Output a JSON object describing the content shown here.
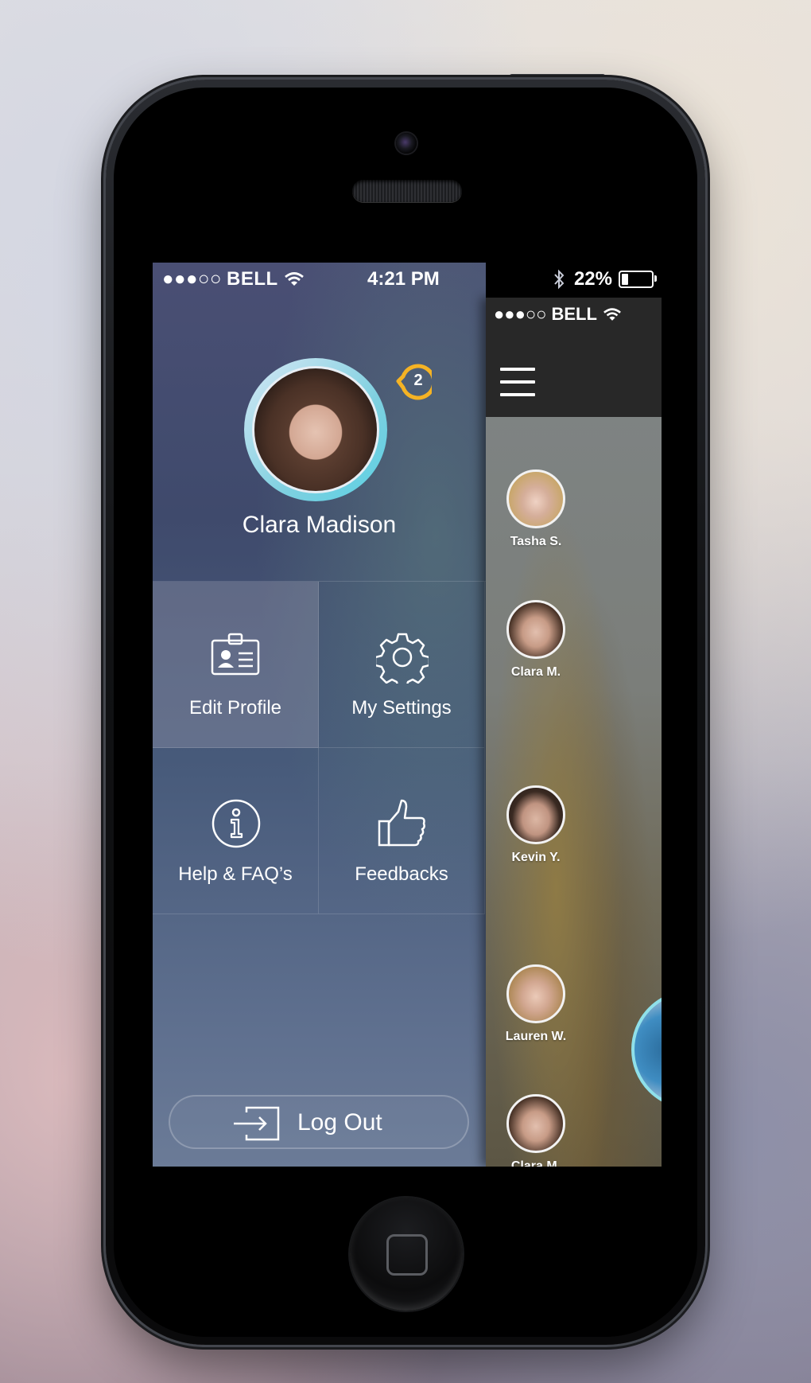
{
  "status_bar": {
    "signal": "●●●○○",
    "carrier": "BELL",
    "time": "4:21 PM",
    "battery_percent": "22%",
    "battery_level": 0.22
  },
  "content_status": {
    "signal": "●●●○○",
    "carrier": "BELL"
  },
  "profile": {
    "name": "Clara Madison",
    "notification_count": "2"
  },
  "menu": {
    "edit_profile": "Edit Profile",
    "my_settings": "My Settings",
    "help": "Help & FAQ’s",
    "feedbacks": "Feedbacks",
    "log_out": "Log Out"
  },
  "contacts": [
    {
      "name": "Tasha S."
    },
    {
      "name": "Clara M."
    },
    {
      "name": "Kevin Y."
    },
    {
      "name": "Lauren W."
    },
    {
      "name": "Clara M."
    }
  ],
  "colors": {
    "accent_badge": "#f5b324",
    "avatar_ring": "#5ad1e3",
    "content_header": "#282828"
  }
}
